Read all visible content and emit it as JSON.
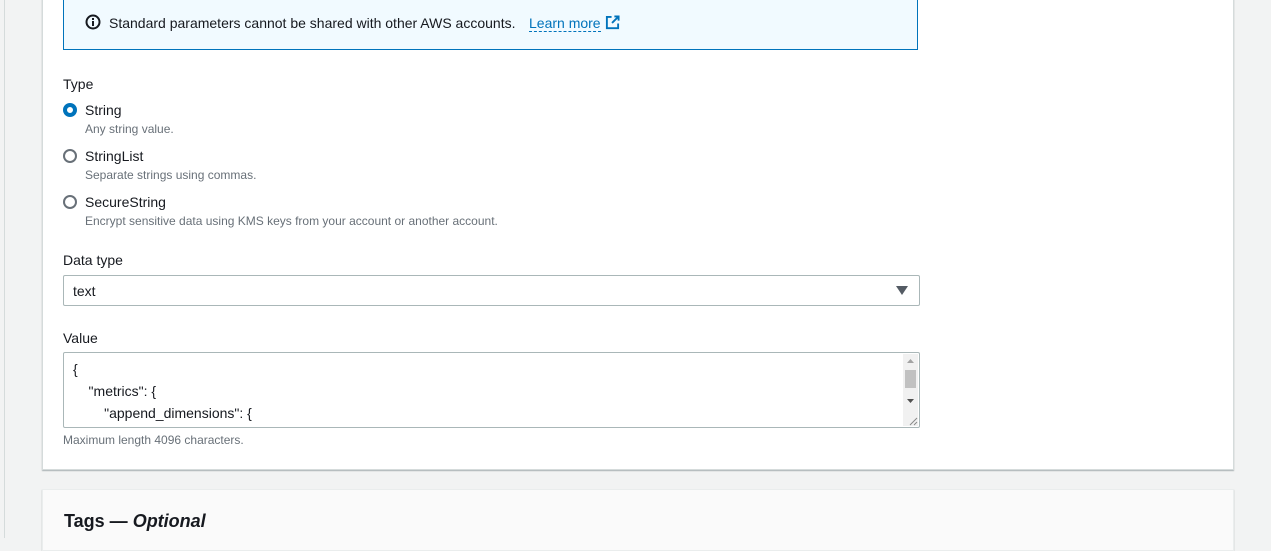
{
  "alert": {
    "message": "Standard parameters cannot be shared with other AWS accounts.",
    "link_label": "Learn more",
    "icons": [
      "info-icon",
      "external-link-icon"
    ]
  },
  "type_field": {
    "label": "Type",
    "options": [
      {
        "label": "String",
        "description": "Any string value.",
        "selected": true
      },
      {
        "label": "StringList",
        "description": "Separate strings using commas.",
        "selected": false
      },
      {
        "label": "SecureString",
        "description": "Encrypt sensitive data using KMS keys from your account or another account.",
        "selected": false
      }
    ]
  },
  "data_type_field": {
    "label": "Data type",
    "value": "text"
  },
  "value_field": {
    "label": "Value",
    "lines": [
      "{",
      "    \"metrics\": {",
      "        \"append_dimensions\": {"
    ],
    "hint": "Maximum length 4096 characters."
  },
  "tags_section": {
    "title": "Tags — ",
    "title_optional": "Optional"
  },
  "colors": {
    "accent": "#0073bb",
    "alert_bg": "#f1faff",
    "text": "#16191f",
    "secondary_text": "#687078",
    "border": "#aab7b8"
  }
}
